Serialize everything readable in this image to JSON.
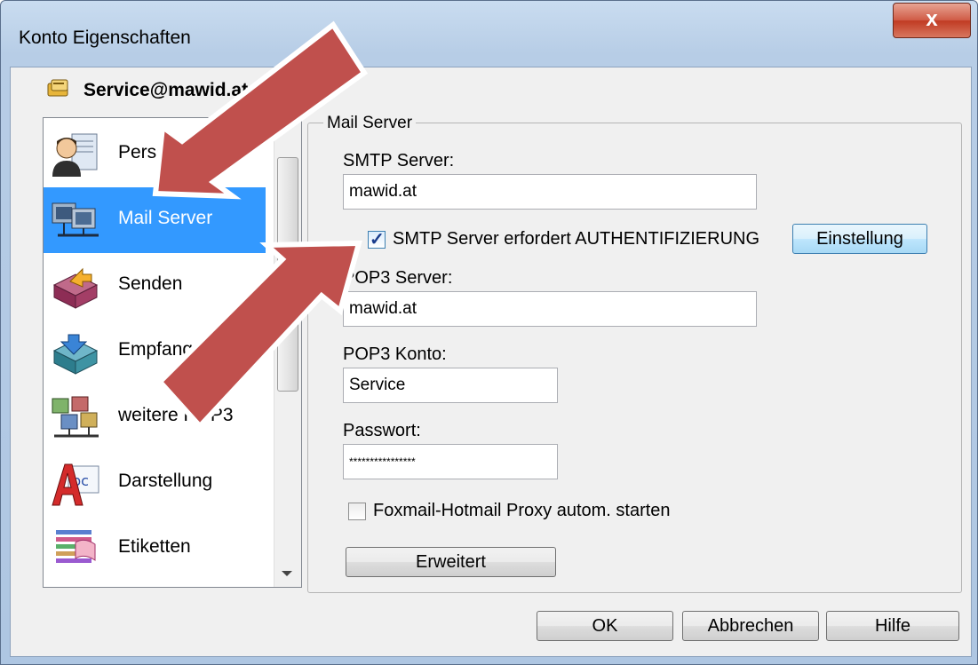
{
  "window": {
    "title": "Konto Eigenschaften",
    "close_glyph": "x"
  },
  "account": {
    "name": "Service@mawid.at",
    "icon": "account-card-icon"
  },
  "nav": {
    "items": [
      {
        "label": "Persönliches",
        "icon": "person-icon"
      },
      {
        "label": "Mail Server",
        "icon": "computers-network-icon",
        "selected": true
      },
      {
        "label": "Senden",
        "icon": "send-box-icon"
      },
      {
        "label": "Empfangen",
        "icon": "receive-box-icon"
      },
      {
        "label": "weitere POP3",
        "icon": "multi-server-icon"
      },
      {
        "label": "Darstellung",
        "icon": "font-abc-icon"
      },
      {
        "label": "Etiketten",
        "icon": "label-flag-icon"
      }
    ]
  },
  "mail_server": {
    "group_label": "Mail Server",
    "smtp_label": "SMTP Server:",
    "smtp_value": "mawid.at",
    "smtp_auth_label": "SMTP Server erfordert AUTHENTIFIZIERUNG",
    "smtp_auth_checked": true,
    "einstellung_label": "Einstellung",
    "pop3_label": "POP3 Server:",
    "pop3_value": "mawid.at",
    "pop3_account_label": "POP3 Konto:",
    "pop3_account_value": "Service",
    "password_label": "Passwort:",
    "password_value": "****************",
    "proxy_label": "Foxmail-Hotmail Proxy autom. starten",
    "proxy_checked": false,
    "advanced_label": "Erweitert"
  },
  "footer": {
    "ok_label": "OK",
    "cancel_label": "Abbrechen",
    "help_label": "Hilfe"
  },
  "colors": {
    "selection": "#3399ff",
    "arrow_fill": "#c0504d",
    "arrow_outline": "#ffffff"
  }
}
